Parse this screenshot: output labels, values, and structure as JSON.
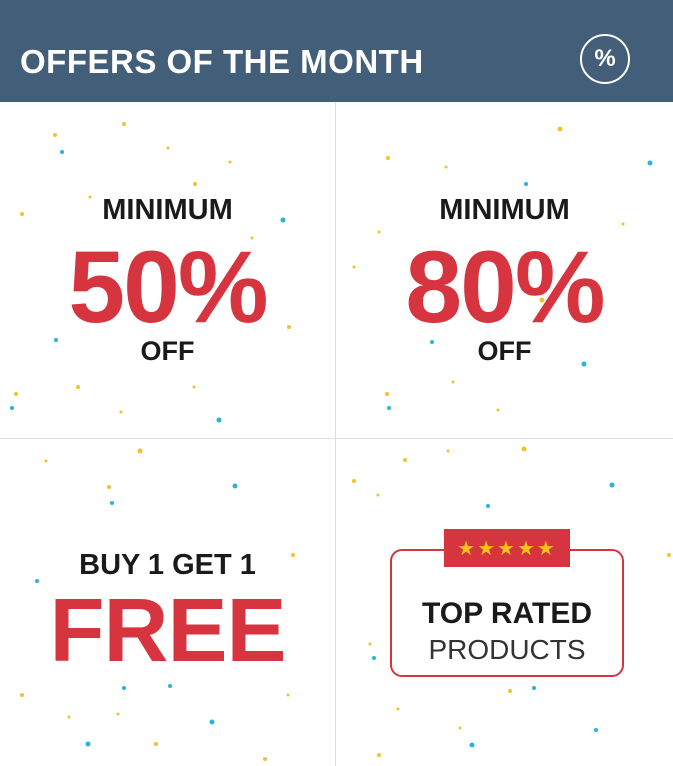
{
  "header": {
    "title": "OFFERS OF THE MONTH",
    "badge_symbol": "%",
    "background_color": "#425e78"
  },
  "offers": [
    {
      "top": "MINIMUM",
      "highlight": "50%",
      "bottom": "OFF"
    },
    {
      "top": "MINIMUM",
      "highlight": "80%",
      "bottom": "OFF"
    },
    {
      "top": "BUY 1 GET 1",
      "highlight": "FREE"
    },
    {
      "stars": "★★★★★",
      "title": "TOP RATED",
      "subtitle": "PRODUCTS"
    }
  ],
  "colors": {
    "accent_red": "#d63540",
    "confetti_yellow": "#f3c12b",
    "confetti_blue": "#2bb4d6"
  },
  "icons": {
    "header_badge": "percent-icon",
    "rating": "star-icon"
  }
}
